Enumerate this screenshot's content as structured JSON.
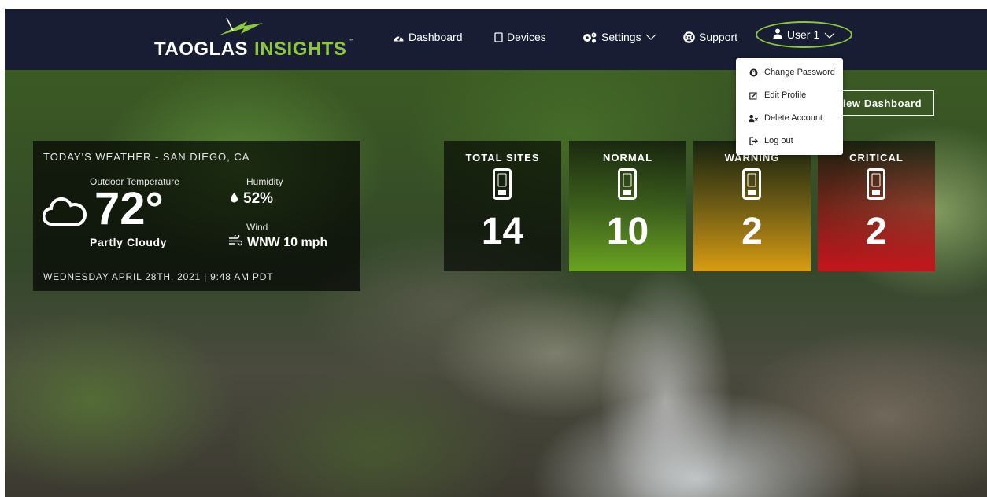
{
  "brand": {
    "part1": "TAOGLAS",
    "part2": "INSIGHTS",
    "tm": "™"
  },
  "nav": {
    "dashboard": "Dashboard",
    "devices": "Devices",
    "settings": "Settings",
    "support": "Support",
    "user": "User 1"
  },
  "user_menu": {
    "change_password": "Change Password",
    "edit_profile": "Edit Profile",
    "delete_account": "Delete Account",
    "log_out": "Log out"
  },
  "view_dashboard": "View Dashboard",
  "weather": {
    "title": "TODAY'S WEATHER - SAN DIEGO, CA",
    "temp_label": "Outdoor Temperature",
    "temperature": "72°",
    "condition": "Partly Cloudy",
    "humidity_label": "Humidity",
    "humidity": "52%",
    "wind_label": "Wind",
    "wind": "WNW 10 mph",
    "datetime": "WEDNESDAY APRIL  28TH, 2021 | 9:48 AM PDT"
  },
  "stats": {
    "total": {
      "label": "TOTAL SITES",
      "value": "14"
    },
    "normal": {
      "label": "NORMAL",
      "value": "10"
    },
    "warning": {
      "label": "WARNING",
      "value": "2"
    },
    "critical": {
      "label": "CRITICAL",
      "value": "2"
    }
  },
  "colors": {
    "navbar": "#181d33",
    "accent_green": "#8dc63f",
    "normal": "#6aa420",
    "warning": "#d99c12",
    "critical": "#c4161c"
  },
  "icons": {
    "dashboard": "gauge-icon",
    "devices": "tablet-icon",
    "settings": "gears-icon",
    "support": "lifebuoy-icon",
    "user": "user-icon",
    "weather": "cloud-icon",
    "humidity": "droplet-icon",
    "wind": "wind-icon",
    "device": "device-icon"
  }
}
